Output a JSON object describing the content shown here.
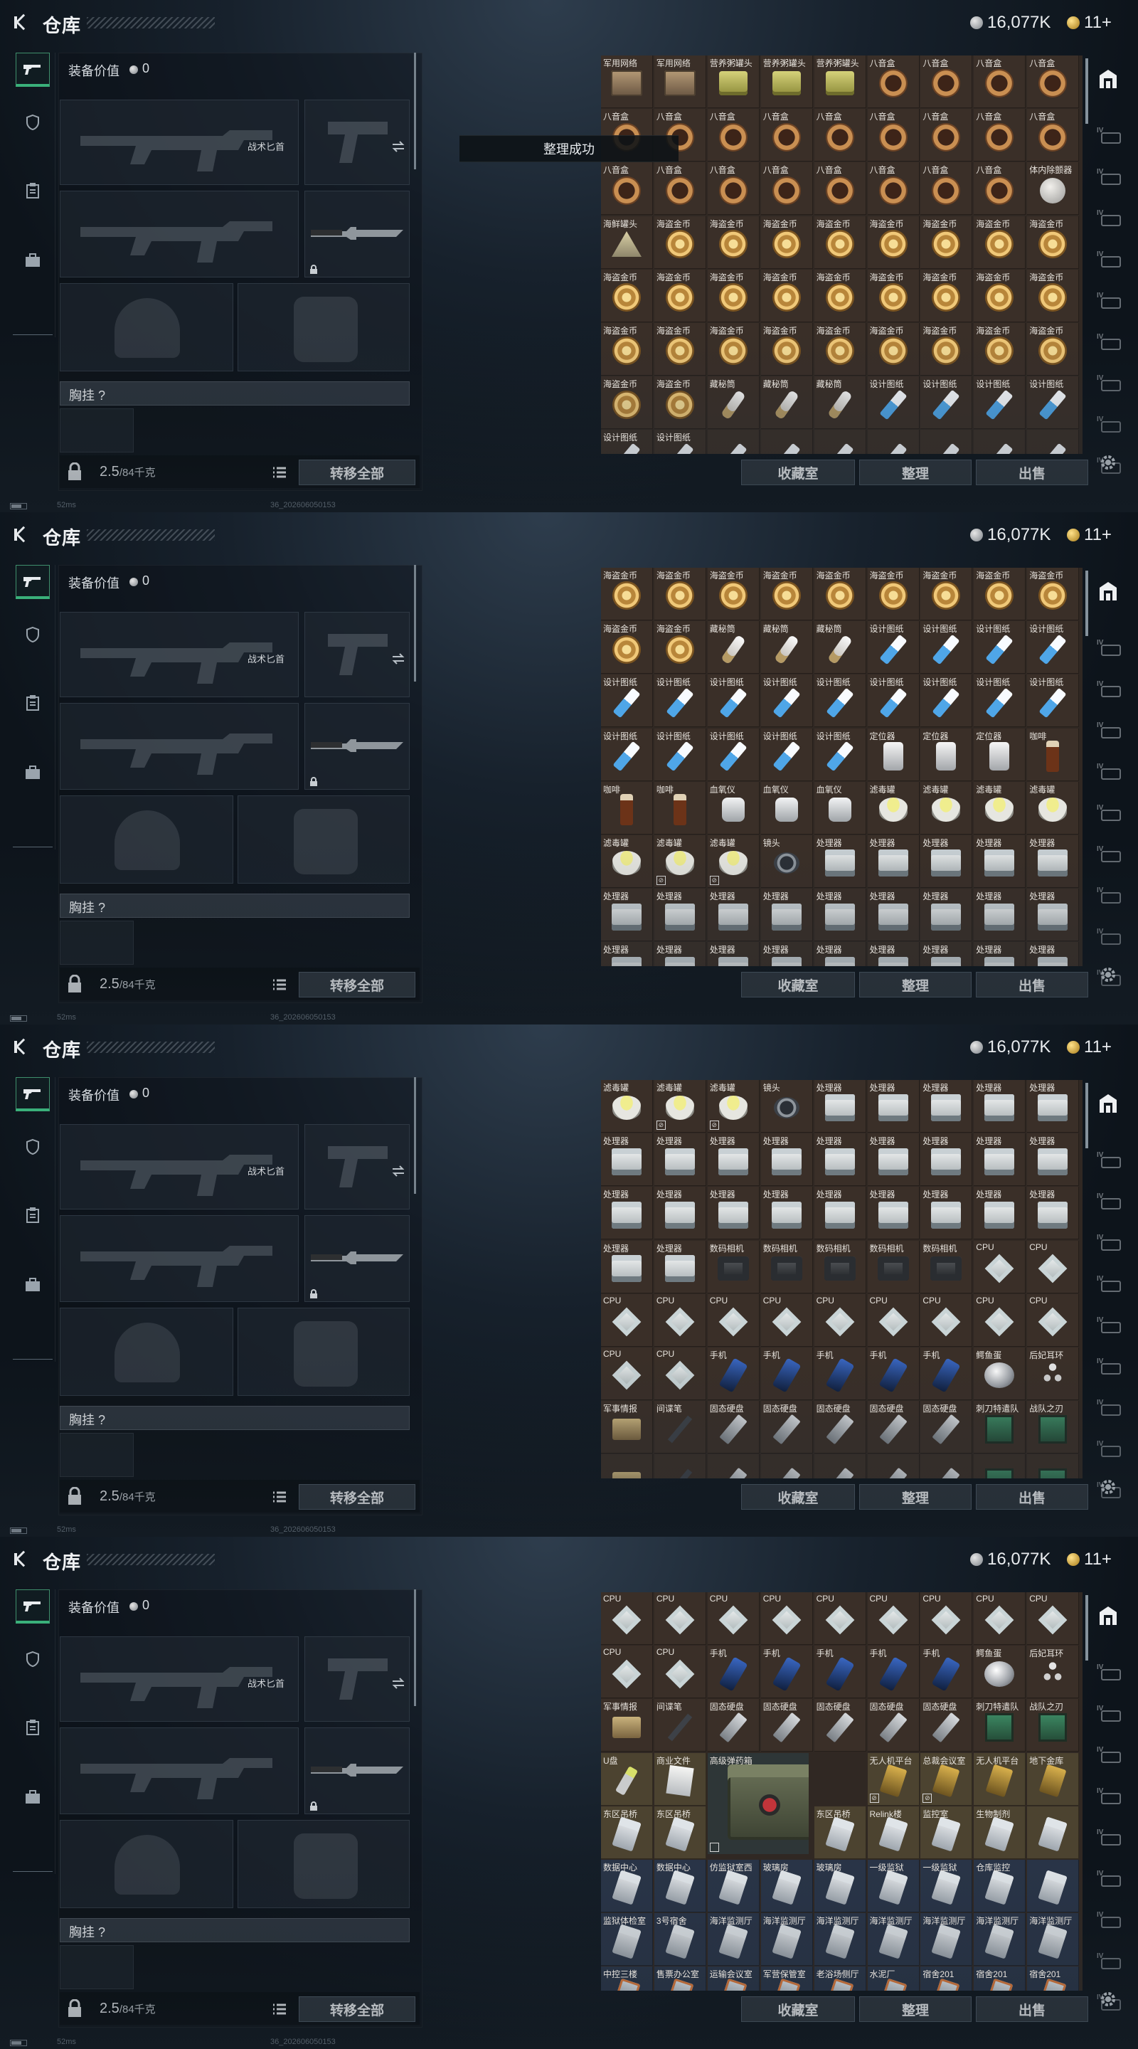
{
  "top": {
    "title": "仓库",
    "silver": "16,077K",
    "gold": "11+"
  },
  "equipment": {
    "value_label": "装备价值",
    "value": "0",
    "knife_label": "战术匕首",
    "vest_label": "胸挂 ?",
    "weight": "2.5",
    "weight_unit": "/84千克",
    "transfer_all": "转移全部"
  },
  "status": {
    "ping": "52ms",
    "build": "36_202606050153"
  },
  "toast": "整理成功",
  "actions": {
    "collection": "收藏室",
    "sort": "整理",
    "sell": "出售"
  },
  "colors": {
    "accent_green": "#3ab07a",
    "cell_brown": "#3a2f28",
    "cell_blue": "#293447",
    "cell_gold": "#4c4330",
    "cell_red": "#473038"
  },
  "panels": [
    {
      "rows": [
        [
          [
            "军用网络",
            "ammo"
          ],
          [
            "军用网络",
            "ammo"
          ],
          [
            "营养粥罐头",
            "can"
          ],
          [
            "营养粥罐头",
            "can"
          ],
          [
            "营养粥罐头",
            "can"
          ],
          [
            "八音盒",
            "ring"
          ],
          [
            "八音盒",
            "ring"
          ],
          [
            "八音盒",
            "ring"
          ],
          [
            "八音盒",
            "ring"
          ]
        ],
        [
          [
            "八音盒",
            "ring"
          ],
          [
            "八音盒",
            "ring"
          ],
          [
            "八音盒",
            "ring"
          ],
          [
            "八音盒",
            "ring"
          ],
          [
            "八音盒",
            "ring"
          ],
          [
            "八音盒",
            "ring"
          ],
          [
            "八音盒",
            "ring"
          ],
          [
            "八音盒",
            "ring"
          ],
          [
            "八音盒",
            "ring"
          ]
        ],
        [
          [
            "八音盒",
            "ring"
          ],
          [
            "八音盒",
            "ring"
          ],
          [
            "八音盒",
            "ring"
          ],
          [
            "八音盒",
            "ring"
          ],
          [
            "八音盒",
            "ring"
          ],
          [
            "八音盒",
            "ring"
          ],
          [
            "八音盒",
            "ring"
          ],
          [
            "八音盒",
            "ring"
          ],
          [
            "体内除颤器",
            "plate"
          ]
        ],
        [
          [
            "海鲜罐头",
            "beacon"
          ],
          [
            "海盗金币",
            "coinx"
          ],
          [
            "海盗金币",
            "coinx"
          ],
          [
            "海盗金币",
            "coinx"
          ],
          [
            "海盗金币",
            "coinx"
          ],
          [
            "海盗金币",
            "coinx"
          ],
          [
            "海盗金币",
            "coinx"
          ],
          [
            "海盗金币",
            "coinx"
          ],
          [
            "海盗金币",
            "coinx"
          ]
        ],
        [
          [
            "海盗金币",
            "coinx"
          ],
          [
            "海盗金币",
            "coinx"
          ],
          [
            "海盗金币",
            "coinx"
          ],
          [
            "海盗金币",
            "coinx"
          ],
          [
            "海盗金币",
            "coinx"
          ],
          [
            "海盗金币",
            "coinx"
          ],
          [
            "海盗金币",
            "coinx"
          ],
          [
            "海盗金币",
            "coinx"
          ],
          [
            "海盗金币",
            "coinx"
          ]
        ],
        [
          [
            "海盗金币",
            "coinx"
          ],
          [
            "海盗金币",
            "coinx"
          ],
          [
            "海盗金币",
            "coinx"
          ],
          [
            "海盗金币",
            "coinx"
          ],
          [
            "海盗金币",
            "coinx"
          ],
          [
            "海盗金币",
            "coinx"
          ],
          [
            "海盗金币",
            "coinx"
          ],
          [
            "海盗金币",
            "coinx"
          ],
          [
            "海盗金币",
            "coinx"
          ]
        ],
        [
          [
            "海盗金币",
            "coinx"
          ],
          [
            "海盗金币",
            "coinx"
          ],
          [
            "藏秘筒",
            "syr"
          ],
          [
            "藏秘筒",
            "syr"
          ],
          [
            "藏秘筒",
            "syr"
          ],
          [
            "设计图纸",
            "blue"
          ],
          [
            "设计图纸",
            "blue"
          ],
          [
            "设计图纸",
            "blue"
          ],
          [
            "设计图纸",
            "blue"
          ]
        ],
        [
          [
            "设计图纸",
            "blue"
          ],
          [
            "设计图纸",
            "blue"
          ],
          [
            "",
            "blue"
          ],
          [
            "",
            "blue"
          ],
          [
            "",
            "blue"
          ],
          [
            "",
            "blue"
          ],
          [
            "",
            "blue"
          ],
          [
            "",
            "blue"
          ],
          [
            "",
            "blue"
          ]
        ]
      ]
    },
    {
      "rows": [
        [
          [
            "海盗金币",
            "coinx"
          ],
          [
            "海盗金币",
            "coinx"
          ],
          [
            "海盗金币",
            "coinx"
          ],
          [
            "海盗金币",
            "coinx"
          ],
          [
            "海盗金币",
            "coinx"
          ],
          [
            "海盗金币",
            "coinx"
          ],
          [
            "海盗金币",
            "coinx"
          ],
          [
            "海盗金币",
            "coinx"
          ],
          [
            "海盗金币",
            "coinx"
          ]
        ],
        [
          [
            "海盗金币",
            "coinx"
          ],
          [
            "海盗金币",
            "coinx"
          ],
          [
            "藏秘筒",
            "syr"
          ],
          [
            "藏秘筒",
            "syr"
          ],
          [
            "藏秘筒",
            "syr"
          ],
          [
            "设计图纸",
            "blue"
          ],
          [
            "设计图纸",
            "blue"
          ],
          [
            "设计图纸",
            "blue"
          ],
          [
            "设计图纸",
            "blue"
          ]
        ],
        [
          [
            "设计图纸",
            "blue"
          ],
          [
            "设计图纸",
            "blue"
          ],
          [
            "设计图纸",
            "blue"
          ],
          [
            "设计图纸",
            "blue"
          ],
          [
            "设计图纸",
            "blue"
          ],
          [
            "设计图纸",
            "blue"
          ],
          [
            "设计图纸",
            "blue"
          ],
          [
            "设计图纸",
            "blue"
          ],
          [
            "设计图纸",
            "blue"
          ]
        ],
        [
          [
            "设计图纸",
            "blue"
          ],
          [
            "设计图纸",
            "blue"
          ],
          [
            "设计图纸",
            "blue"
          ],
          [
            "设计图纸",
            "blue"
          ],
          [
            "设计图纸",
            "blue"
          ],
          [
            "定位器",
            "gps"
          ],
          [
            "定位器",
            "gps"
          ],
          [
            "定位器",
            "gps"
          ],
          [
            "咖啡",
            "bottle"
          ]
        ],
        [
          [
            "咖啡",
            "bottle"
          ],
          [
            "咖啡",
            "bottle"
          ],
          [
            "血氧仪",
            "ox"
          ],
          [
            "血氧仪",
            "ox"
          ],
          [
            "血氧仪",
            "ox"
          ],
          [
            "滤毒罐",
            "filt"
          ],
          [
            "滤毒罐",
            "filt"
          ],
          [
            "滤毒罐",
            "filt"
          ],
          [
            "滤毒罐",
            "filt"
          ]
        ],
        [
          [
            "滤毒罐",
            "filt"
          ],
          [
            "滤毒罐",
            "filt",
            1
          ],
          [
            "滤毒罐",
            "filt",
            1
          ],
          [
            "镜头",
            "lens"
          ],
          [
            "处理器",
            "kit"
          ],
          [
            "处理器",
            "kit"
          ],
          [
            "处理器",
            "kit"
          ],
          [
            "处理器",
            "kit"
          ],
          [
            "处理器",
            "kit"
          ]
        ],
        [
          [
            "处理器",
            "kit"
          ],
          [
            "处理器",
            "kit"
          ],
          [
            "处理器",
            "kit"
          ],
          [
            "处理器",
            "kit"
          ],
          [
            "处理器",
            "kit"
          ],
          [
            "处理器",
            "kit"
          ],
          [
            "处理器",
            "kit"
          ],
          [
            "处理器",
            "kit"
          ],
          [
            "处理器",
            "kit"
          ]
        ],
        [
          [
            "处理器",
            "kit"
          ],
          [
            "处理器",
            "kit"
          ],
          [
            "处理器",
            "kit"
          ],
          [
            "处理器",
            "kit"
          ],
          [
            "处理器",
            "kit"
          ],
          [
            "处理器",
            "kit"
          ],
          [
            "处理器",
            "kit"
          ],
          [
            "处理器",
            "kit"
          ],
          [
            "处理器",
            "kit"
          ]
        ]
      ]
    },
    {
      "rows": [
        [
          [
            "滤毒罐",
            "filt"
          ],
          [
            "滤毒罐",
            "filt",
            1
          ],
          [
            "滤毒罐",
            "filt",
            1
          ],
          [
            "镜头",
            "lens"
          ],
          [
            "处理器",
            "kit"
          ],
          [
            "处理器",
            "kit"
          ],
          [
            "处理器",
            "kit"
          ],
          [
            "处理器",
            "kit"
          ],
          [
            "处理器",
            "kit"
          ]
        ],
        [
          [
            "处理器",
            "kit"
          ],
          [
            "处理器",
            "kit"
          ],
          [
            "处理器",
            "kit"
          ],
          [
            "处理器",
            "kit"
          ],
          [
            "处理器",
            "kit"
          ],
          [
            "处理器",
            "kit"
          ],
          [
            "处理器",
            "kit"
          ],
          [
            "处理器",
            "kit"
          ],
          [
            "处理器",
            "kit"
          ]
        ],
        [
          [
            "处理器",
            "kit"
          ],
          [
            "处理器",
            "kit"
          ],
          [
            "处理器",
            "kit"
          ],
          [
            "处理器",
            "kit"
          ],
          [
            "处理器",
            "kit"
          ],
          [
            "处理器",
            "kit"
          ],
          [
            "处理器",
            "kit"
          ],
          [
            "处理器",
            "kit"
          ],
          [
            "处理器",
            "kit"
          ]
        ],
        [
          [
            "处理器",
            "kit"
          ],
          [
            "处理器",
            "kit"
          ],
          [
            "数码相机",
            "cam"
          ],
          [
            "数码相机",
            "cam"
          ],
          [
            "数码相机",
            "cam"
          ],
          [
            "数码相机",
            "cam"
          ],
          [
            "数码相机",
            "cam"
          ],
          [
            "CPU",
            "cpu"
          ],
          [
            "CPU",
            "cpu"
          ]
        ],
        [
          [
            "CPU",
            "cpu"
          ],
          [
            "CPU",
            "cpu"
          ],
          [
            "CPU",
            "cpu"
          ],
          [
            "CPU",
            "cpu"
          ],
          [
            "CPU",
            "cpu"
          ],
          [
            "CPU",
            "cpu"
          ],
          [
            "CPU",
            "cpu"
          ],
          [
            "CPU",
            "cpu"
          ],
          [
            "CPU",
            "cpu"
          ]
        ],
        [
          [
            "CPU",
            "cpu"
          ],
          [
            "CPU",
            "cpu"
          ],
          [
            "手机",
            "phone"
          ],
          [
            "手机",
            "phone"
          ],
          [
            "手机",
            "phone"
          ],
          [
            "手机",
            "phone"
          ],
          [
            "手机",
            "phone"
          ],
          [
            "鳄鱼蛋",
            "pearl"
          ],
          [
            "后妃耳环",
            "earring"
          ]
        ],
        [
          [
            "军事情报",
            "intel"
          ],
          [
            "间谍笔",
            "pen"
          ],
          [
            "固态硬盘",
            "ssd"
          ],
          [
            "固态硬盘",
            "ssd"
          ],
          [
            "固态硬盘",
            "ssd"
          ],
          [
            "固态硬盘",
            "ssd"
          ],
          [
            "固态硬盘",
            "ssd"
          ],
          [
            "刺刀特遣队",
            "cover"
          ],
          [
            "战队之刃",
            "cover"
          ]
        ],
        [
          [
            "",
            "intel"
          ],
          [
            "",
            "pen"
          ],
          [
            "",
            "ssd"
          ],
          [
            "",
            "ssd"
          ],
          [
            "",
            "ssd"
          ],
          [
            "",
            "ssd"
          ],
          [
            "",
            "ssd"
          ],
          [
            "",
            "cover"
          ],
          [
            "",
            "cover"
          ]
        ]
      ]
    },
    {
      "rows": [
        [
          [
            "CPU",
            "cpu"
          ],
          [
            "CPU",
            "cpu"
          ],
          [
            "CPU",
            "cpu"
          ],
          [
            "CPU",
            "cpu"
          ],
          [
            "CPU",
            "cpu"
          ],
          [
            "CPU",
            "cpu"
          ],
          [
            "CPU",
            "cpu"
          ],
          [
            "CPU",
            "cpu"
          ],
          [
            "CPU",
            "cpu"
          ]
        ],
        [
          [
            "CPU",
            "cpu"
          ],
          [
            "CPU",
            "cpu"
          ],
          [
            "手机",
            "phone"
          ],
          [
            "手机",
            "phone"
          ],
          [
            "手机",
            "phone"
          ],
          [
            "手机",
            "phone"
          ],
          [
            "手机",
            "phone"
          ],
          [
            "鳄鱼蛋",
            "pearl"
          ],
          [
            "后妃耳环",
            "earring"
          ]
        ],
        [
          [
            "军事情报",
            "intel"
          ],
          [
            "间谍笔",
            "pen"
          ],
          [
            "固态硬盘",
            "ssd"
          ],
          [
            "固态硬盘",
            "ssd"
          ],
          [
            "固态硬盘",
            "ssd"
          ],
          [
            "固态硬盘",
            "ssd"
          ],
          [
            "固态硬盘",
            "ssd"
          ],
          [
            "刺刀特遣队",
            "cover"
          ],
          [
            "战队之刃",
            "cover"
          ]
        ],
        [
          [
            "U盘",
            "usb"
          ],
          [
            "商业文件",
            "doc"
          ],
          [
            "高级弹药箱",
            "big"
          ],
          [
            "",
            "big"
          ],
          [
            "",
            "big"
          ],
          [
            "无人机平台",
            "keyc",
            1
          ],
          [
            "总裁会议室",
            "keyc",
            1
          ],
          [
            "无人机平台",
            "keyc"
          ],
          [
            "地下金库",
            "keyc"
          ]
        ],
        [
          [
            "东区吊桥",
            "card"
          ],
          [
            "东区吊桥",
            "card"
          ],
          [
            "",
            "big"
          ],
          [
            "",
            "big"
          ],
          [
            "东区吊桥",
            "card"
          ],
          [
            "Relink楼",
            "card"
          ],
          [
            "监控室",
            "card"
          ],
          [
            "生物制剂",
            "card"
          ],
          [
            "",
            "card"
          ]
        ],
        [
          [
            "数据中心",
            "card"
          ],
          [
            "数据中心",
            "card"
          ],
          [
            "仿监狱室西",
            "card"
          ],
          [
            "玻璃房",
            "card"
          ],
          [
            "玻璃房",
            "card"
          ],
          [
            "一级监狱",
            "card"
          ],
          [
            "一级监狱",
            "card"
          ],
          [
            "仓库监控",
            "card"
          ],
          [
            "",
            "card"
          ]
        ],
        [
          [
            "监狱体检室",
            "card"
          ],
          [
            "3号宿舍",
            "card"
          ],
          [
            "海洋监测厅",
            "card"
          ],
          [
            "海洋监测厅",
            "card"
          ],
          [
            "海洋监测厅",
            "card"
          ],
          [
            "海洋监测厅",
            "card"
          ],
          [
            "海洋监测厅",
            "card"
          ],
          [
            "海洋监测厅",
            "card"
          ],
          [
            "海洋监测厅",
            "card"
          ]
        ],
        [
          [
            "中控三楼",
            "keyb"
          ],
          [
            "售票办公室",
            "keyb"
          ],
          [
            "运输会议室",
            "keyb"
          ],
          [
            "军营保管室",
            "keyb"
          ],
          [
            "老浴场侧厅",
            "keyb"
          ],
          [
            "水泥厂",
            "keyb"
          ],
          [
            "宿舍201",
            "keyb"
          ],
          [
            "宿舍201",
            "keyb"
          ],
          [
            "宿舍201",
            "keyb"
          ]
        ]
      ]
    }
  ]
}
